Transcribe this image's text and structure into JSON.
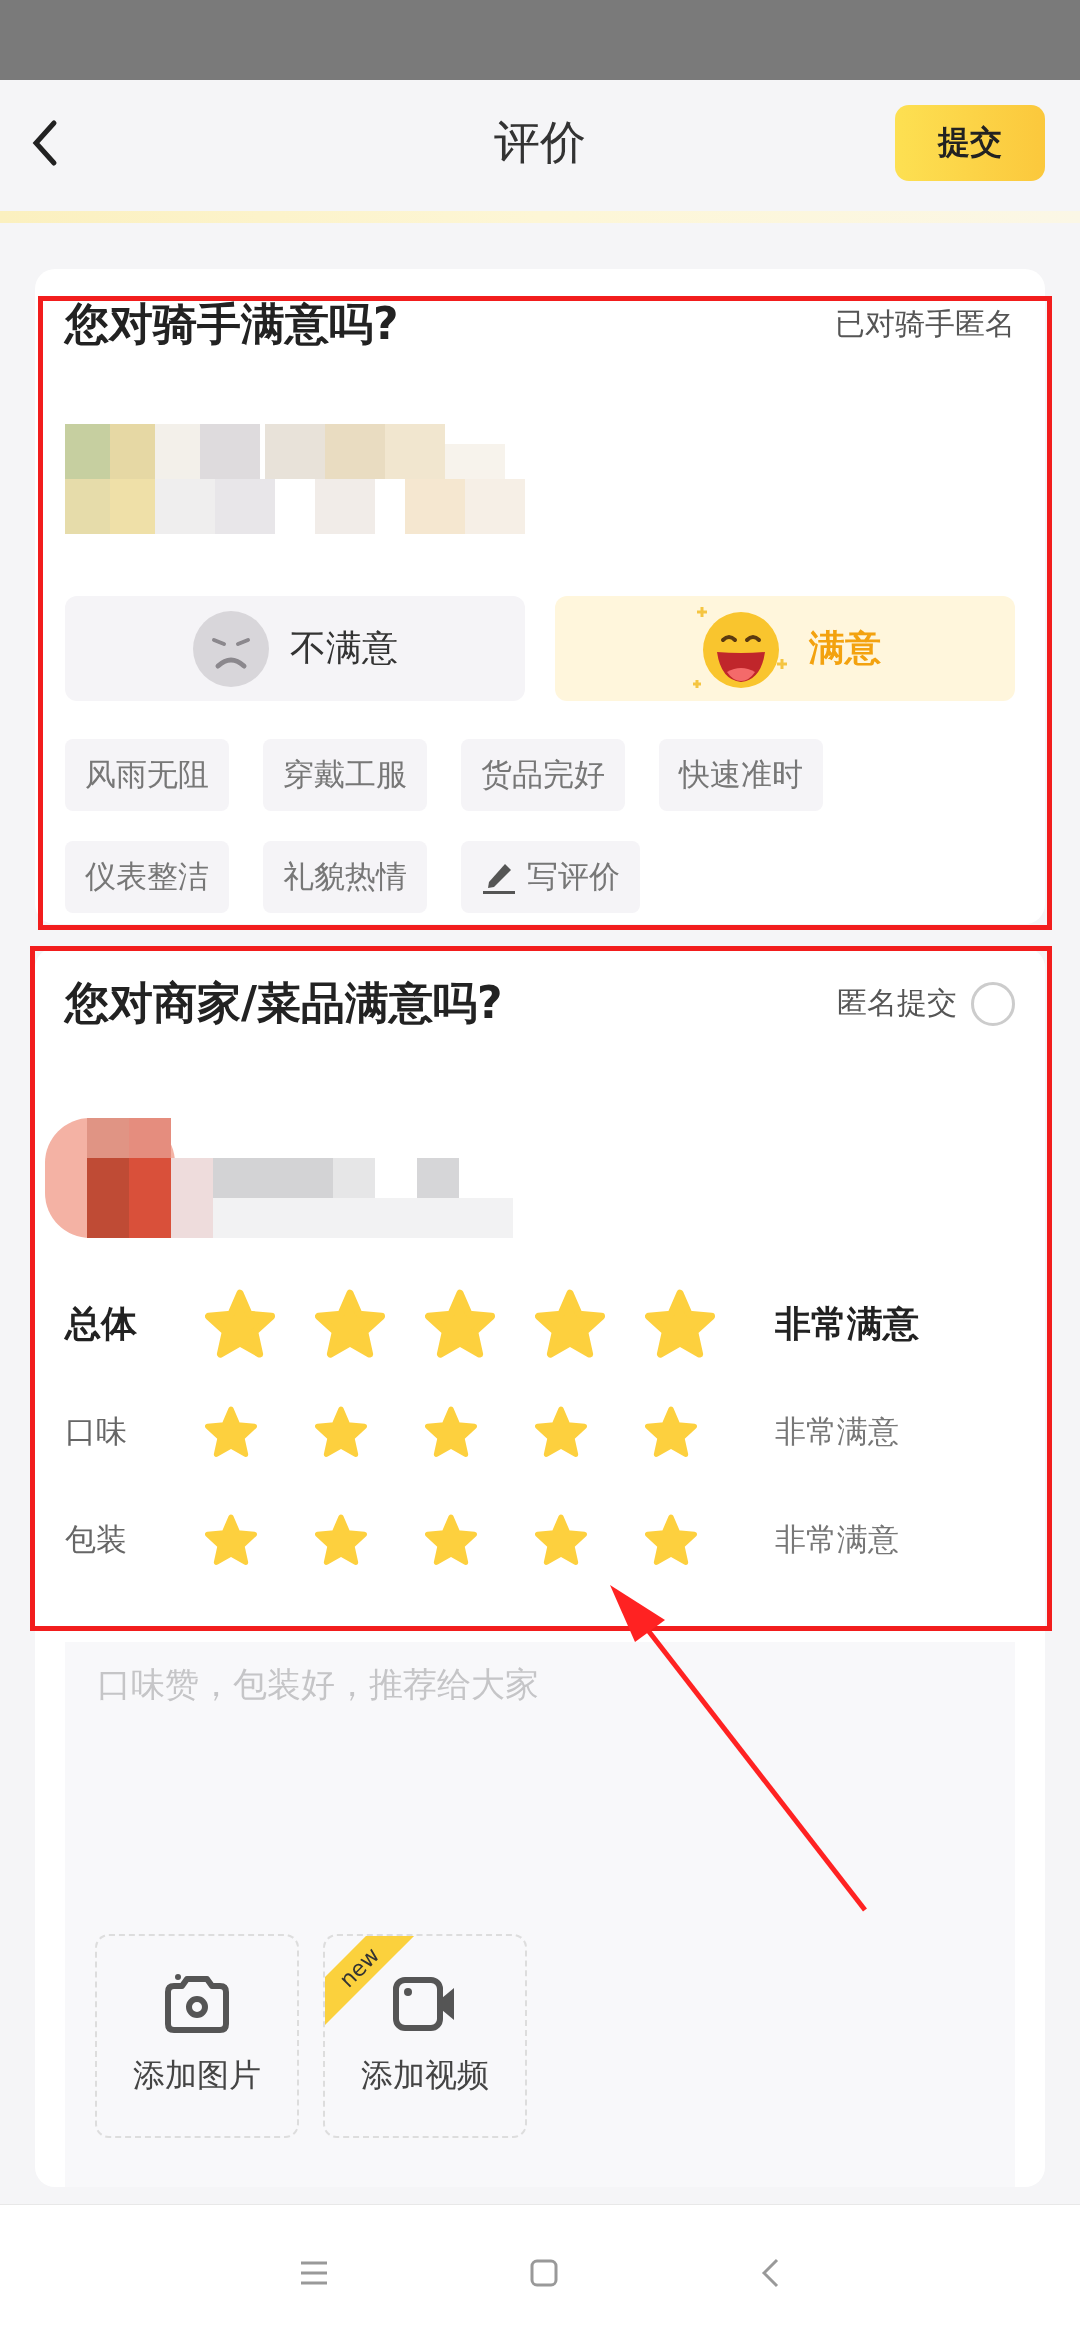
{
  "header": {
    "title": "评价",
    "submit": "提交"
  },
  "rider": {
    "title": "您对骑手满意吗?",
    "note": "已对骑手匿名",
    "options": [
      {
        "kind": "unhappy",
        "label": "不满意",
        "selected": false
      },
      {
        "kind": "happy",
        "label": "满意",
        "selected": true
      }
    ],
    "tags": [
      {
        "kind": "tag",
        "label": "风雨无阻",
        "selected": false
      },
      {
        "kind": "tag",
        "label": "穿戴工服",
        "selected": false
      },
      {
        "kind": "tag",
        "label": "货品完好",
        "selected": false
      },
      {
        "kind": "tag",
        "label": "快速准时",
        "selected": false
      },
      {
        "kind": "tag",
        "label": "仪表整洁",
        "selected": false
      },
      {
        "kind": "tag",
        "label": "礼貌热情",
        "selected": false
      },
      {
        "kind": "write",
        "label": "写评价",
        "selected": false
      }
    ]
  },
  "merchant": {
    "title": "您对商家/菜品满意吗?",
    "anonymous": {
      "label": "匿名提交",
      "checked": false
    },
    "ratings": [
      {
        "kind": "main",
        "label": "总体",
        "stars": 5,
        "reading": "非常满意"
      },
      {
        "kind": "sub",
        "label": "口味",
        "stars": 5,
        "reading": "非常满意"
      },
      {
        "kind": "sub",
        "label": "包装",
        "stars": 5,
        "reading": "非常满意"
      }
    ],
    "comment": {
      "placeholder": "口味赞，包装好，推荐给大家"
    },
    "uploads": [
      {
        "label": "添加图片"
      },
      {
        "kind": "video",
        "label": "添加视频",
        "badge": "new"
      }
    ]
  }
}
